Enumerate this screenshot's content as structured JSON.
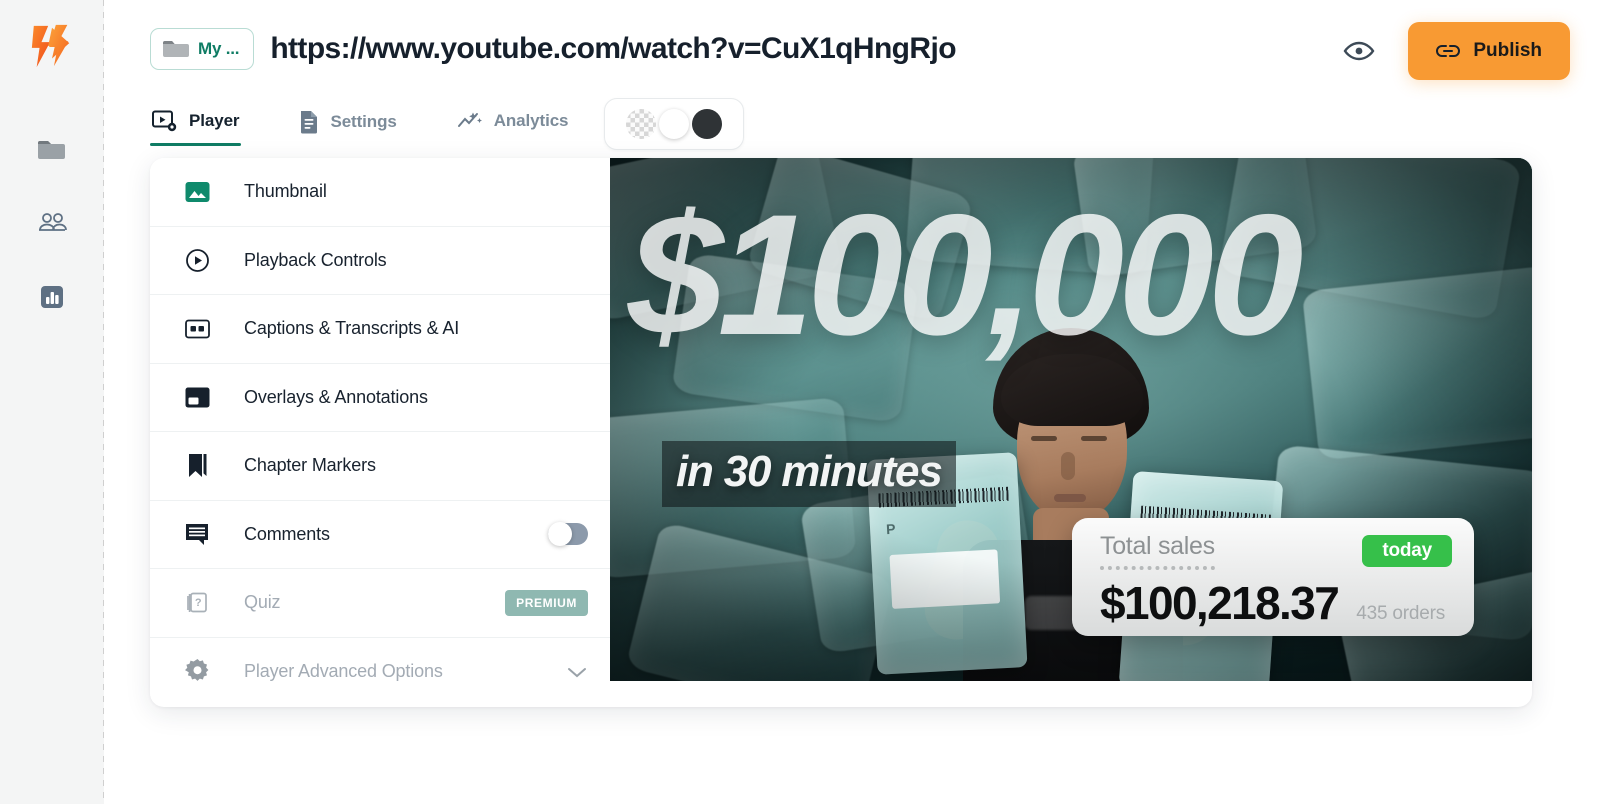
{
  "brand": {
    "logo_icon": "lightning-play-logo",
    "accent_orange": "#f89a33",
    "accent_teal": "#0f7c64"
  },
  "rail": {
    "items": [
      {
        "icon": "folder-icon",
        "name": "folders"
      },
      {
        "icon": "people-icon",
        "name": "team"
      },
      {
        "icon": "bar-chart-icon",
        "name": "analytics"
      }
    ]
  },
  "header": {
    "folder_chip": {
      "icon": "folder-icon",
      "label": "My ..."
    },
    "url": "https://www.youtube.com/watch?v=CuX1qHngRjo",
    "preview_icon": "eye-icon",
    "publish": {
      "icon": "link-icon",
      "label": "Publish"
    }
  },
  "tabs": [
    {
      "label": "Player",
      "icon": "player-settings-icon",
      "active": true
    },
    {
      "label": "Settings",
      "icon": "document-icon",
      "active": false
    },
    {
      "label": "Analytics",
      "icon": "sparkle-chart-icon",
      "active": false
    }
  ],
  "background_swatches": [
    {
      "name": "transparent",
      "selected": false
    },
    {
      "name": "white",
      "selected": false
    },
    {
      "name": "dark",
      "selected": true,
      "color": "#2f3336"
    }
  ],
  "menu": {
    "items": [
      {
        "label": "Thumbnail",
        "icon": "image-icon",
        "disabled": false,
        "control": "none"
      },
      {
        "label": "Playback Controls",
        "icon": "play-circle-icon",
        "disabled": false,
        "control": "none"
      },
      {
        "label": "Captions & Transcripts & AI",
        "icon": "cc-icon",
        "disabled": false,
        "control": "none"
      },
      {
        "label": "Overlays & Annotations",
        "icon": "overlay-icon",
        "disabled": false,
        "control": "none"
      },
      {
        "label": "Chapter Markers",
        "icon": "bookmark-icon",
        "disabled": false,
        "control": "none"
      },
      {
        "label": "Comments",
        "icon": "comment-icon",
        "disabled": false,
        "control": "toggle",
        "toggle_on": false
      },
      {
        "label": "Quiz",
        "icon": "quiz-icon",
        "disabled": true,
        "control": "badge",
        "badge": "PREMIUM"
      },
      {
        "label": "Player Advanced Options",
        "icon": "gear-icon",
        "disabled": true,
        "control": "chevron"
      }
    ]
  },
  "thumbnail": {
    "headline": "$100,000",
    "subline": "in 30 minutes",
    "sales_card": {
      "label": "Total sales",
      "badge": "today",
      "amount": "$100,218.37",
      "orders": "435 orders"
    },
    "bag_mark": "P"
  }
}
